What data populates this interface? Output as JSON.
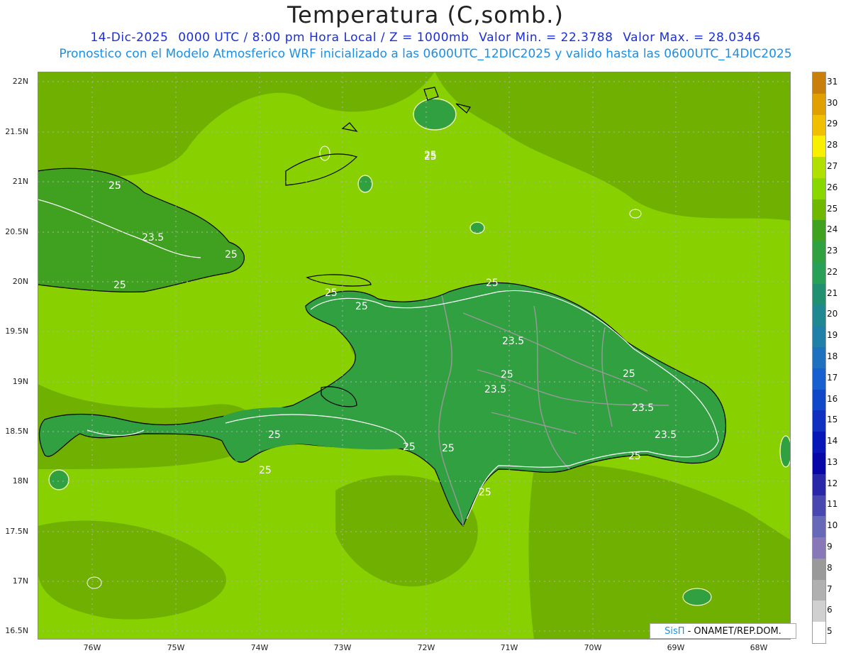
{
  "title": "Temperatura (C,somb.)",
  "subtitle_line1": {
    "date": "14-Dic-2025",
    "time": "0000 UTC / 8:00 pm Hora Local / Z = 1000mb",
    "min": "Valor Min. = 22.3788",
    "max": "Valor Max. = 28.0346"
  },
  "subtitle_line2": "Pronostico con el Modelo Atmosferico WRF inicializado a las 0600UTC_12DIC2025 y valido hasta las  0600UTC_14DIC2025",
  "y_ticks": [
    "22N",
    "21.5N",
    "21N",
    "20.5N",
    "20N",
    "19.5N",
    "19N",
    "18.5N",
    "18N",
    "17.5N",
    "17N",
    "16.5N"
  ],
  "x_ticks": [
    "76W",
    "75W",
    "74W",
    "73W",
    "72W",
    "71W",
    "70W",
    "69W",
    "68W"
  ],
  "contour_labels": [
    "25",
    "25",
    "23.5",
    "25",
    "25",
    "25",
    "25",
    "25",
    "23.5",
    "25",
    "23.5",
    "25",
    "23.5",
    "23.5",
    "25",
    "25",
    "25",
    "25",
    "25",
    "25",
    "25",
    "25"
  ],
  "colorbar": {
    "labels": [
      "31",
      "30",
      "29",
      "28",
      "27",
      "26",
      "25",
      "24",
      "23",
      "22",
      "21",
      "20",
      "19",
      "18",
      "17",
      "16",
      "15",
      "14",
      "13",
      "12",
      "11",
      "10",
      "9",
      "8",
      "7",
      "6",
      "5"
    ],
    "colors": [
      "#c8800a",
      "#e0a000",
      "#f0c000",
      "#f8f000",
      "#b0e000",
      "#88d800",
      "#70b800",
      "#40a020",
      "#30a040",
      "#28a058",
      "#209070",
      "#208890",
      "#2080a8",
      "#2070c0",
      "#1860d0",
      "#1048c8",
      "#1030c0",
      "#0818b8",
      "#0808a8",
      "#2828a8",
      "#4848b0",
      "#6868b8",
      "#8878b8",
      "#9a9a9a",
      "#b0b0b0",
      "#d0d0d0",
      "#ffffff"
    ]
  },
  "credit": {
    "brand": "SisΠ",
    "text": "- ONAMET/REP.DOM."
  }
}
